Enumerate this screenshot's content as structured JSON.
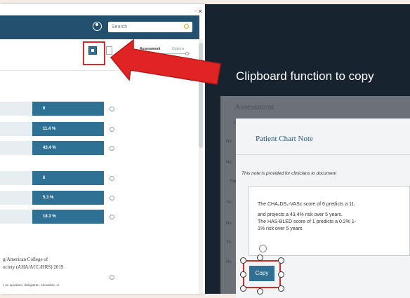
{
  "header": {
    "search_placeholder": "Search"
  },
  "tabs": {
    "assessment": "Assessment",
    "options": "Options"
  },
  "scores_group1": [
    "6",
    "11.4 %",
    "43.4 %"
  ],
  "scores_group2": [
    "6",
    "5.3 %",
    "18.3 %"
  ],
  "guideline": {
    "line1": "g/American College of",
    "line2": "ociety (AHA/ACC/HRS) 2019",
    "fine": "ς an apixaban, dabigatran, edoxaban, or"
  },
  "overlay": {
    "headline": "Clipboard function to copy",
    "background_title": "Assessment",
    "side_labels": [
      "Yea",
      "No",
      "No",
      "Fema",
      "Ye",
      "No",
      "Ye",
      "No"
    ]
  },
  "modal": {
    "title": "Patient Chart Note",
    "intro": "This note is provided for clinicians to document",
    "note_lines": [
      "The CHA₂DS₂-VASc score of 6 predicts a 11.",
      "and projects a 43.4% risk over 5 years.",
      "The HAS-BLED score of 1 predicts a 0.2% 1-",
      "1% risk over 5 years."
    ],
    "copy_label": "Copy"
  },
  "colors": {
    "header": "#23506f",
    "value_bar": "#2f7194",
    "highlight": "#d42a2a",
    "arrow": "#e02424"
  }
}
